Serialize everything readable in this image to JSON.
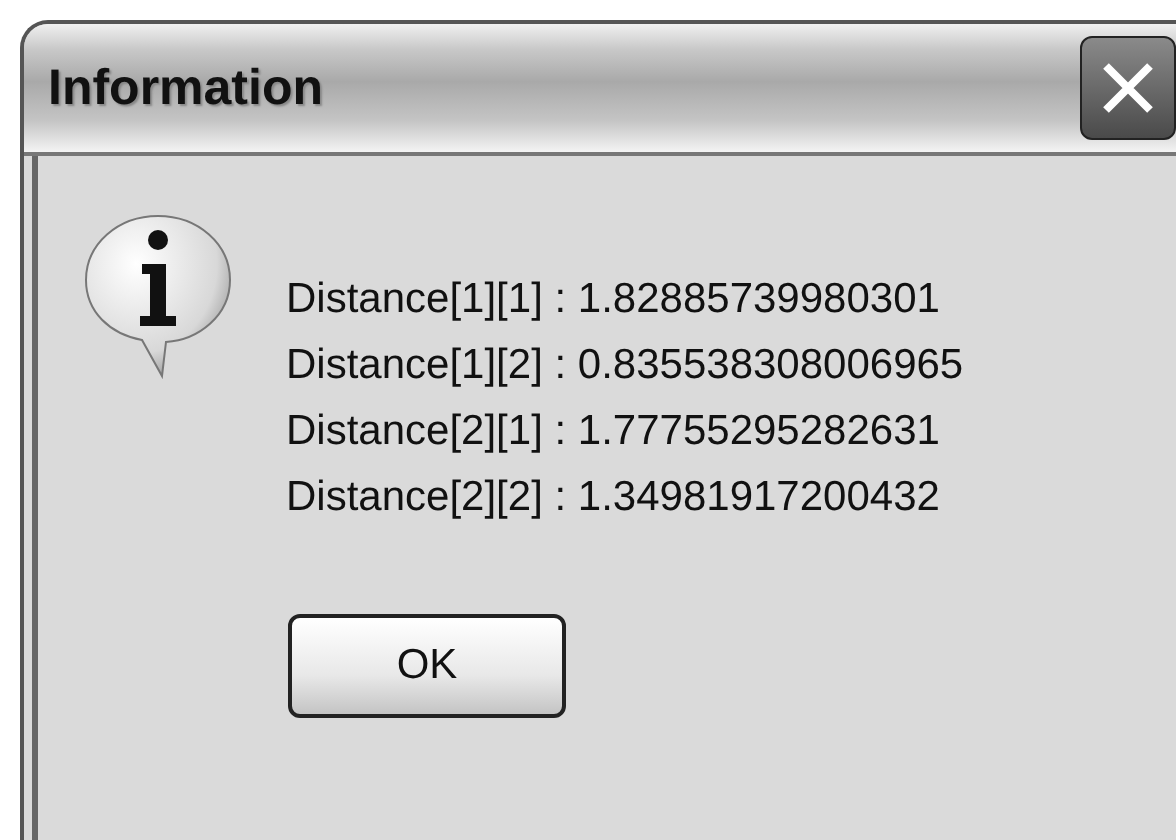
{
  "window": {
    "title": "Information"
  },
  "message": {
    "lines": [
      "Distance[1][1] : 1.82885739980301",
      "Distance[1][2] : 0.835538308006965",
      "Distance[2][1] : 1.77755295282631",
      "Distance[2][2] : 1.34981917200432"
    ]
  },
  "buttons": [
    "OK"
  ]
}
